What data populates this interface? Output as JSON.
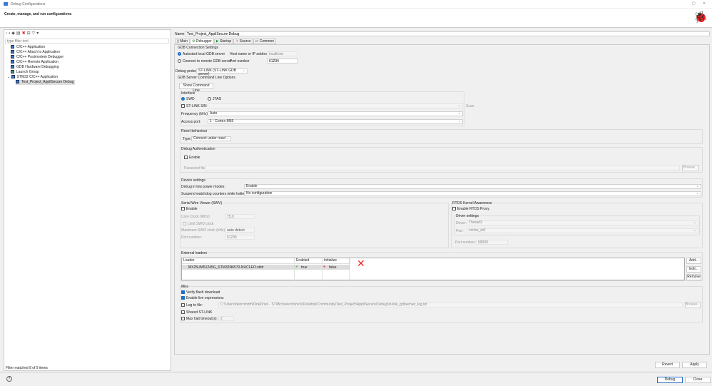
{
  "window": {
    "title": "Debug Configurations",
    "header": "Create, manage, and run configurations"
  },
  "left": {
    "filter_placeholder": "type filter text",
    "tree": [
      "C/C++ Application",
      "C/C++ Attach to Application",
      "C/C++ Postmortem Debugger",
      "C/C++ Remote Application",
      "GDB Hardware Debugging",
      "Launch Group",
      "STM32 C/C++ Application"
    ],
    "child": "Test_Project_AppliSecure Debug",
    "footer": "Filter matched 8 of 9 items"
  },
  "name": {
    "label": "Name:",
    "value": "Test_Project_AppliSecure Debug"
  },
  "tabs": [
    "Main",
    "Debugger",
    "Startup",
    "Source",
    "Common"
  ],
  "gdb": {
    "title": "GDB Connection Settings",
    "autostart": "Autostart local GDB server",
    "remote": "Connect to remote GDB server",
    "host_label": "Host name or IP address",
    "host_value": "localhost",
    "port_label": "Port number",
    "port_value": "61234"
  },
  "probe": {
    "label": "Debug probe",
    "value": "ST-LINK (ST-LINK GDB server)"
  },
  "server_opts": {
    "title": "GDB Server Command Line Options",
    "show_cmd": "Show Command Line"
  },
  "interface": {
    "title": "Interface",
    "swd": "SWD",
    "jtag": "JTAG",
    "sn": "ST-LINK S/N",
    "scan": "Scan",
    "freq_label": "Frequency (kHz):",
    "freq_value": "Auto",
    "ap_label": "Access port:",
    "ap_value": "1 - Cortex-M55"
  },
  "reset": {
    "title": "Reset behaviour",
    "type_label": "Type:",
    "type_value": "Connect under reset"
  },
  "auth": {
    "title": "Debug Authentication",
    "enable": "Enable",
    "password": "Password file",
    "browse": "Browse..."
  },
  "device": {
    "title": "Device settings",
    "lp_label": "Debug in low power modes:",
    "lp_value": "Enable",
    "wd_label": "Suspend watchdog counters while halted:",
    "wd_value": "No configuration"
  },
  "swv": {
    "title": "Serial Wire Viewer (SWV)",
    "enable": "Enable",
    "core_label": "Core Clock (MHz):",
    "core_value": "75.0",
    "limit": "Limit SWO clock",
    "max_label": "Maximum SWO clock (kHz):",
    "max_value": "auto detect",
    "port_label": "Port number:",
    "port_value": "61235"
  },
  "rtos": {
    "title": "RTOS Kernel Awareness",
    "enable": "Enable RTOS Proxy",
    "driver_title": "Driver settings",
    "driver_label": "Driver:",
    "driver_value": "ThreadX",
    "port_label": "Port:",
    "port_value": "cortex_m0",
    "portnum_label": "Port number:",
    "portnum_value": "60000"
  },
  "loaders": {
    "title": "External loaders",
    "headers": [
      "Loader",
      "Enabled",
      "Initialize"
    ],
    "row": {
      "loader": "MX25UM51245G_STM32N6570-NUCLEO.stldr",
      "enabled": "true",
      "initialize": "false"
    },
    "add": "Add...",
    "edit": "Edit...",
    "remove": "Remove"
  },
  "misc": {
    "title": "Misc",
    "verify": "Verify flash download",
    "live": "Enable live expressions",
    "log": "Log to file:",
    "log_path": "C:\\Users\\benromdm\\OneDrive - STMicroelectronics\\Desktop\\Community\\Test_Project\\AppliSecure\\Debug\\st-link_gdbserver_log.txt",
    "browse": "Browse...",
    "shared": "Shared ST-LINK",
    "maxhalt": "Max halt timeout(s):",
    "maxhalt_value": "2"
  },
  "buttons": {
    "revert": "Revert",
    "apply": "Apply",
    "debug": "Debug",
    "close": "Close"
  }
}
